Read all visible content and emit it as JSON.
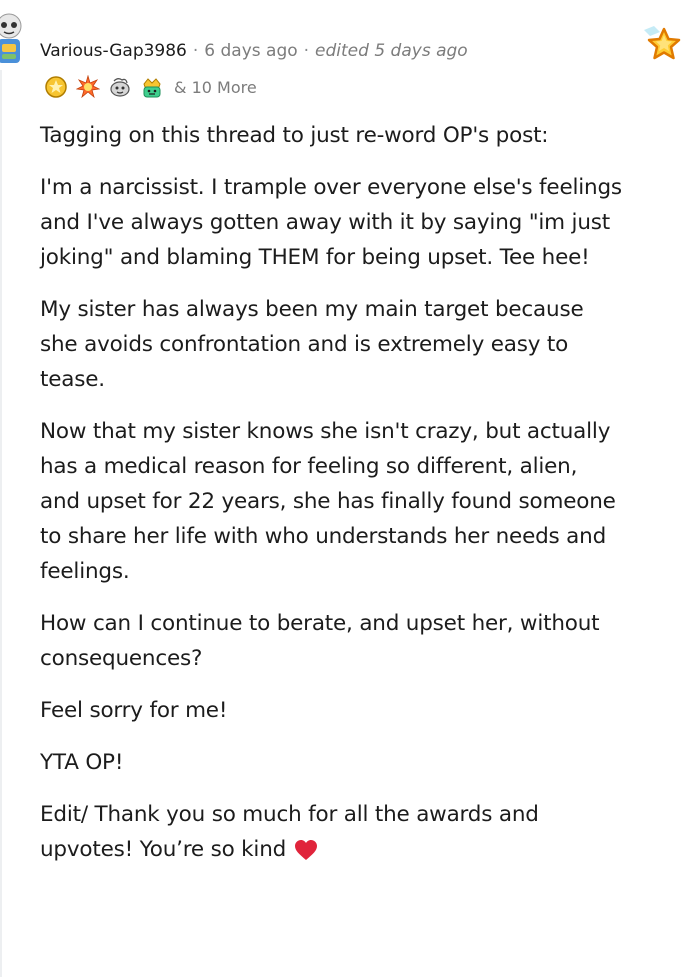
{
  "comment": {
    "username": "Various-Gap3986",
    "separator": "·",
    "posted_time": "6 days ago",
    "edited_time": "edited 5 days ago",
    "awards": {
      "icons": [
        "gold-award-icon",
        "burst-award-icon",
        "wholesome-award-icon",
        "crown-award-icon"
      ],
      "more_label": "& 10 More"
    },
    "body": {
      "p1": "Tagging on this thread to just re-word OP's post:",
      "p2": "I'm a narcissist. I trample over everyone else's feelings\nand I've always gotten away with it by saying \"im just\njoking\" and blaming THEM for being upset. Tee hee!",
      "p3": "My sister has always been my main target because\nshe avoids confrontation and is extremely easy to\ntease.",
      "p4": "Now that my sister knows she isn't crazy, but actually\nhas a medical reason for feeling so different, alien,\nand upset for 22 years, she has finally found someone\nto share her life with who understands her needs and\nfeelings.",
      "p5": "How can I continue to berate, and upset her, without\nconsequences?",
      "p6": "Feel sorry for me!",
      "p7": "YTA OP!",
      "p8": "Edit/ Thank you so much for all the awards and\nupvotes! You’re so kind"
    },
    "colors": {
      "text": "#1c1c1c",
      "meta": "#7c7c7c",
      "heart": "#e0243b",
      "star": "#ffb000"
    }
  }
}
